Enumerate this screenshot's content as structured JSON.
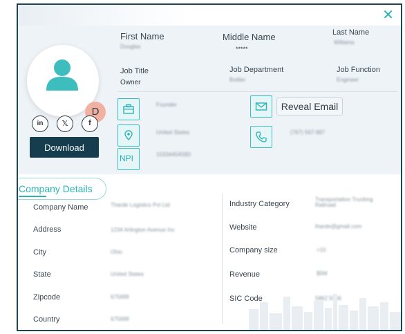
{
  "dialog": {
    "close_glyph": "✕"
  },
  "profile": {
    "initial": "D",
    "download_label": "Download",
    "socials": [
      {
        "icon": "linkedin-icon",
        "glyph": "in"
      },
      {
        "icon": "x-icon",
        "glyph": "𝕏"
      },
      {
        "icon": "facebook-icon",
        "glyph": "f"
      }
    ]
  },
  "name_fields": {
    "first_name_label": "First Name",
    "first_name_value": "Douglas",
    "middle_name_label": "Middle Name",
    "middle_name_value": "*****",
    "last_name_label": "Last Name",
    "last_name_value": "Williams"
  },
  "job_fields": {
    "job_title_label": "Job Title",
    "job_title_value": "Owner",
    "job_department_label": "Job Department",
    "job_department_value": "Bottler",
    "job_function_label": "Job Function",
    "job_function_value": "Engineer"
  },
  "contact": {
    "role_value": "Founder",
    "location_value": "United States",
    "npi_label": "NPI",
    "npi_value": "1033445459D",
    "reveal_email_label": "Reveal Email",
    "phone_value": "(767) 567-987"
  },
  "company": {
    "section_title": "Company Details",
    "left": [
      {
        "label": "Company Name",
        "value": "Tharde Logistics Pvt Ltd"
      },
      {
        "label": "Address",
        "value": "1234 Arlington Avenue Inc"
      },
      {
        "label": "City",
        "value": "Ohio"
      },
      {
        "label": "State",
        "value": "United States"
      },
      {
        "label": "Zipcode",
        "value": "675699"
      },
      {
        "label": "Country",
        "value": "675699"
      }
    ],
    "right": [
      {
        "label": "Industry Category",
        "value": "Transportation Trucking Railroad"
      },
      {
        "label": "Website",
        "value": "tharde@gmail.com"
      },
      {
        "label": "Company size",
        "value": "<10"
      },
      {
        "label": "Revenue",
        "value": "$5M"
      },
      {
        "label": "SIC Code",
        "value": "5862 5566"
      }
    ]
  },
  "colors": {
    "accent": "#2bb3b8",
    "dark": "#163d4e",
    "badge": "#f2b1a0",
    "panel": "#eef3f8"
  }
}
